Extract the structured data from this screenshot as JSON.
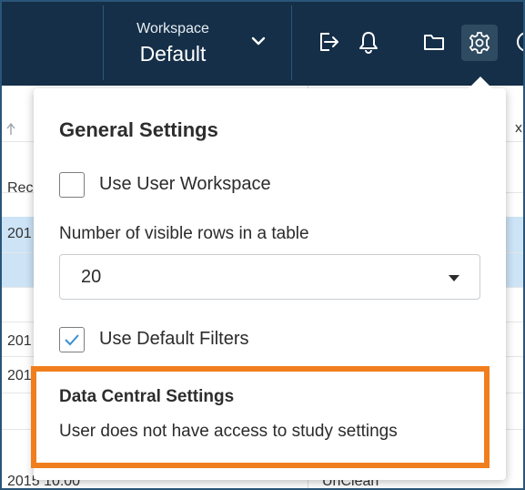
{
  "header": {
    "workspace_label": "Workspace",
    "workspace_value": "Default",
    "icons": [
      "export-icon",
      "bell-icon",
      "folder-icon",
      "gear-icon",
      "help-icon"
    ]
  },
  "background_table": {
    "column_header_fragment": "Rec",
    "row_fragments": [
      "201",
      "201",
      "201"
    ],
    "bottom_left_fragment": "2015 10:00",
    "bottom_right_fragment": "UnClean"
  },
  "settings_popover": {
    "title": "General Settings",
    "use_user_workspace": {
      "label": "Use User Workspace",
      "checked": false
    },
    "rows_field": {
      "label": "Number of visible rows in a table",
      "value": "20"
    },
    "use_default_filters": {
      "label": "Use Default Filters",
      "checked": true
    },
    "data_central": {
      "title": "Data Central Settings",
      "message": "User does not have access to study settings"
    }
  },
  "colors": {
    "header_bg": "#152f48",
    "accent_blue": "#3a8fd1",
    "highlight_orange": "#f07e1d",
    "selected_row": "#cde4f7"
  }
}
